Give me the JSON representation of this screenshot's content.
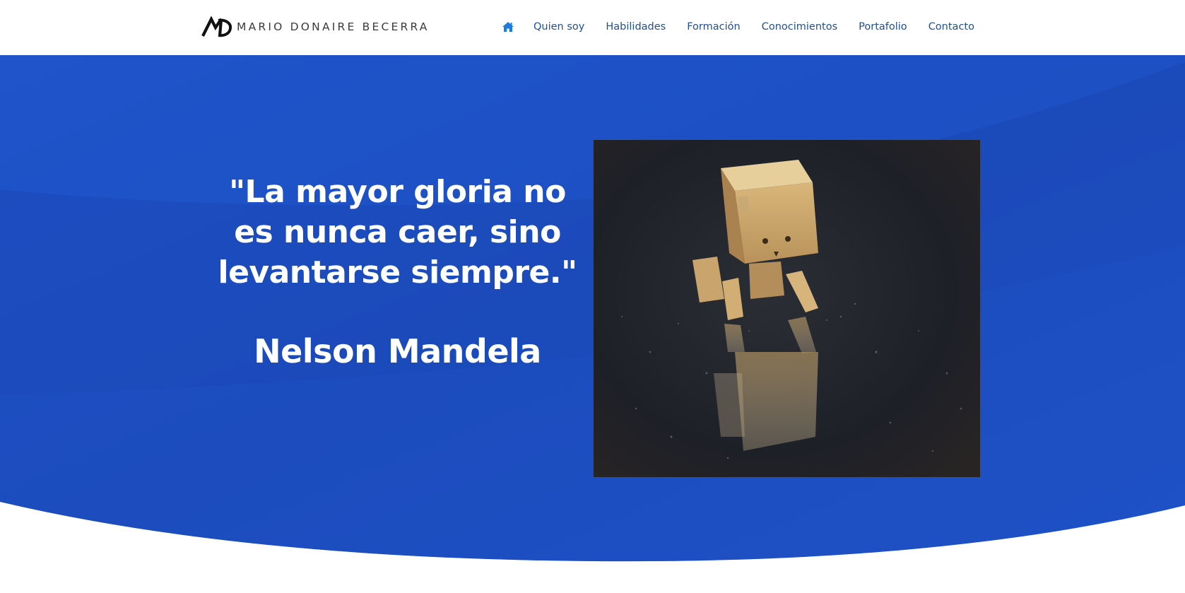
{
  "brand": {
    "name": "MARIO DONAIRE BECERRA",
    "logo_icon": "md-monogram-logo"
  },
  "nav": {
    "home_icon": "home-icon",
    "home_color": "#1e7be0",
    "items": [
      {
        "label": "Quien soy"
      },
      {
        "label": "Habilidades"
      },
      {
        "label": "Formación"
      },
      {
        "label": "Conocimientos"
      },
      {
        "label": "Portafolio"
      },
      {
        "label": "Contacto"
      }
    ]
  },
  "hero": {
    "background_color": "#1e4fc2",
    "quote": "\"La mayor gloria no es nunca caer, sino levantarse siempre.\"",
    "author": "Nelson Mandela",
    "image_subject": "cardboard box robot figure on wet dark floor"
  }
}
